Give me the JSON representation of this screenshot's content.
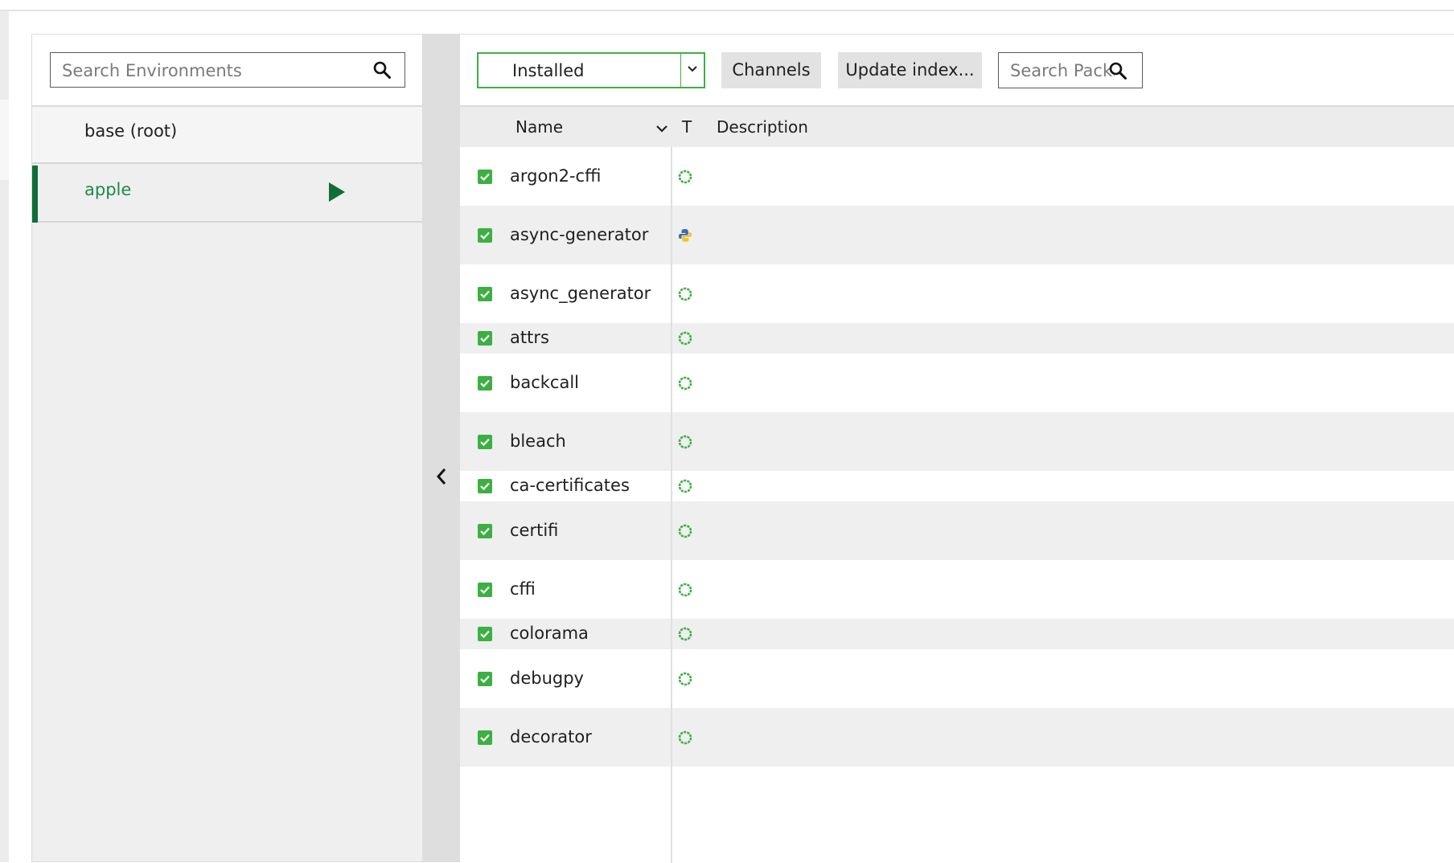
{
  "environments": {
    "search": {
      "placeholder": "Search Environments"
    },
    "items": [
      {
        "label": "base (root)",
        "selected": false
      },
      {
        "label": "apple",
        "selected": true
      }
    ],
    "accent_color": "#1d8a4c"
  },
  "packages": {
    "filter": {
      "selected": "Installed"
    },
    "buttons": {
      "channels": "Channels",
      "update_index": "Update index..."
    },
    "search": {
      "placeholder": "Search Pack..."
    },
    "columns": {
      "name": "Name",
      "type": "T",
      "description": "Description"
    },
    "rows": [
      {
        "name": "argon2-cffi",
        "type_icon": "conda-icon",
        "checked": true
      },
      {
        "name": "async-generator",
        "type_icon": "python-icon",
        "checked": true
      },
      {
        "name": "async_generator",
        "type_icon": "conda-icon",
        "checked": true
      },
      {
        "name": "attrs",
        "type_icon": "conda-icon",
        "checked": true
      },
      {
        "name": "backcall",
        "type_icon": "conda-icon",
        "checked": true
      },
      {
        "name": "bleach",
        "type_icon": "conda-icon",
        "checked": true
      },
      {
        "name": "ca-certificates",
        "type_icon": "conda-icon",
        "checked": true
      },
      {
        "name": "certifi",
        "type_icon": "conda-icon",
        "checked": true
      },
      {
        "name": "cffi",
        "type_icon": "conda-icon",
        "checked": true
      },
      {
        "name": "colorama",
        "type_icon": "conda-icon",
        "checked": true
      },
      {
        "name": "debugpy",
        "type_icon": "conda-icon",
        "checked": true
      },
      {
        "name": "decorator",
        "type_icon": "conda-icon",
        "checked": true
      }
    ],
    "colors": {
      "checkbox": "#3cb043",
      "conda": "#3cb043"
    }
  }
}
